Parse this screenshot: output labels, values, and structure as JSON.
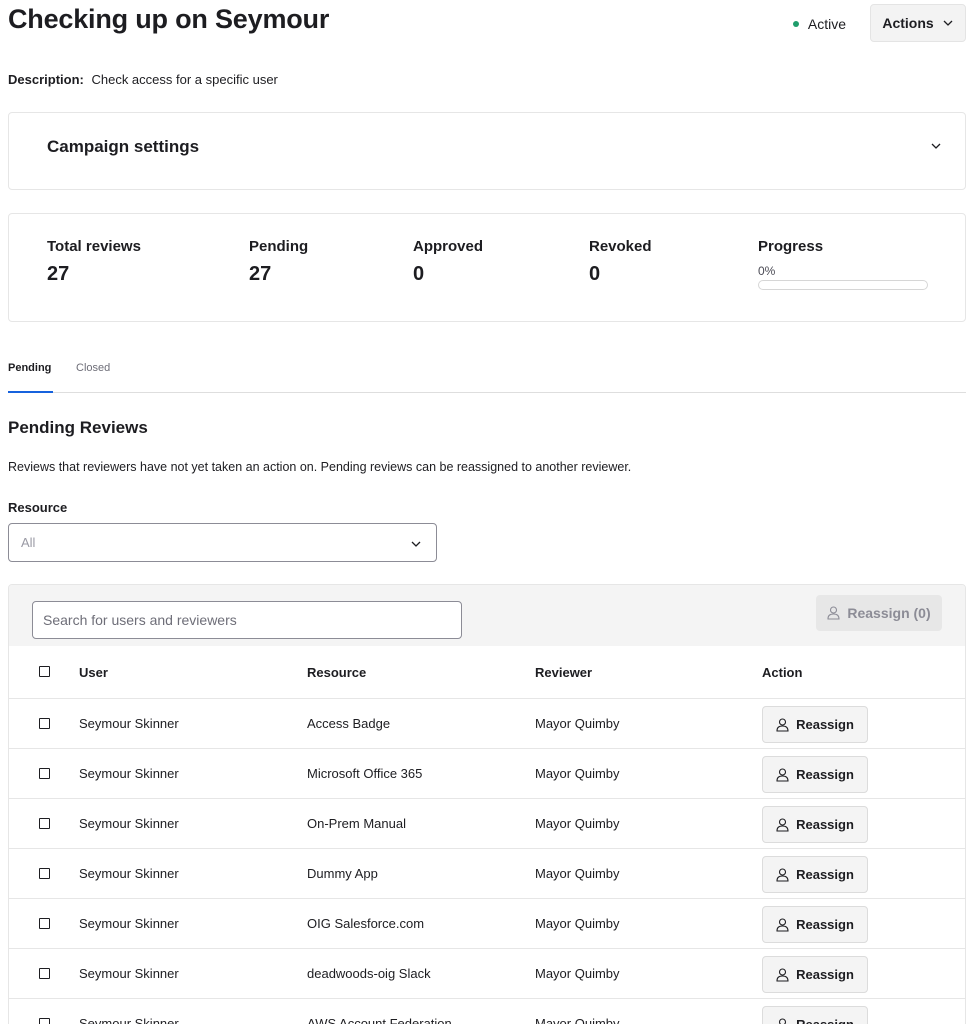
{
  "header": {
    "title": "Checking up on Seymour",
    "status": "Active",
    "actions_label": "Actions"
  },
  "description": {
    "label": "Description:",
    "text": "Check access for a specific user"
  },
  "settings": {
    "title": "Campaign settings"
  },
  "stats": {
    "total_label": "Total reviews",
    "total_value": "27",
    "pending_label": "Pending",
    "pending_value": "27",
    "approved_label": "Approved",
    "approved_value": "0",
    "revoked_label": "Revoked",
    "revoked_value": "0",
    "progress_label": "Progress",
    "progress_text": "0%",
    "progress_fraction": 0
  },
  "tabs": [
    {
      "label": "Pending",
      "active": true
    },
    {
      "label": "Closed",
      "active": false
    }
  ],
  "section": {
    "title": "Pending Reviews",
    "description": "Reviews that reviewers have not yet taken an action on. Pending reviews can be reassigned to another reviewer."
  },
  "filter": {
    "label": "Resource",
    "value": "All"
  },
  "table": {
    "search_placeholder": "Search for users and reviewers",
    "reassign_all_label": "Reassign (0)",
    "columns": [
      "User",
      "Resource",
      "Reviewer",
      "Action"
    ],
    "action_label": "Reassign",
    "rows": [
      {
        "user": "Seymour Skinner",
        "resource": "Access Badge",
        "reviewer": "Mayor Quimby"
      },
      {
        "user": "Seymour Skinner",
        "resource": "Microsoft Office 365",
        "reviewer": "Mayor Quimby"
      },
      {
        "user": "Seymour Skinner",
        "resource": "On-Prem Manual",
        "reviewer": "Mayor Quimby"
      },
      {
        "user": "Seymour Skinner",
        "resource": "Dummy App",
        "reviewer": "Mayor Quimby"
      },
      {
        "user": "Seymour Skinner",
        "resource": "OIG Salesforce.com",
        "reviewer": "Mayor Quimby"
      },
      {
        "user": "Seymour Skinner",
        "resource": "deadwoods-oig Slack",
        "reviewer": "Mayor Quimby"
      },
      {
        "user": "Seymour Skinner",
        "resource": "AWS Account Federation",
        "reviewer": "Mayor Quimby"
      }
    ]
  },
  "colors": {
    "active_dot": "#1f9d6b",
    "accent": "#1662dd"
  }
}
